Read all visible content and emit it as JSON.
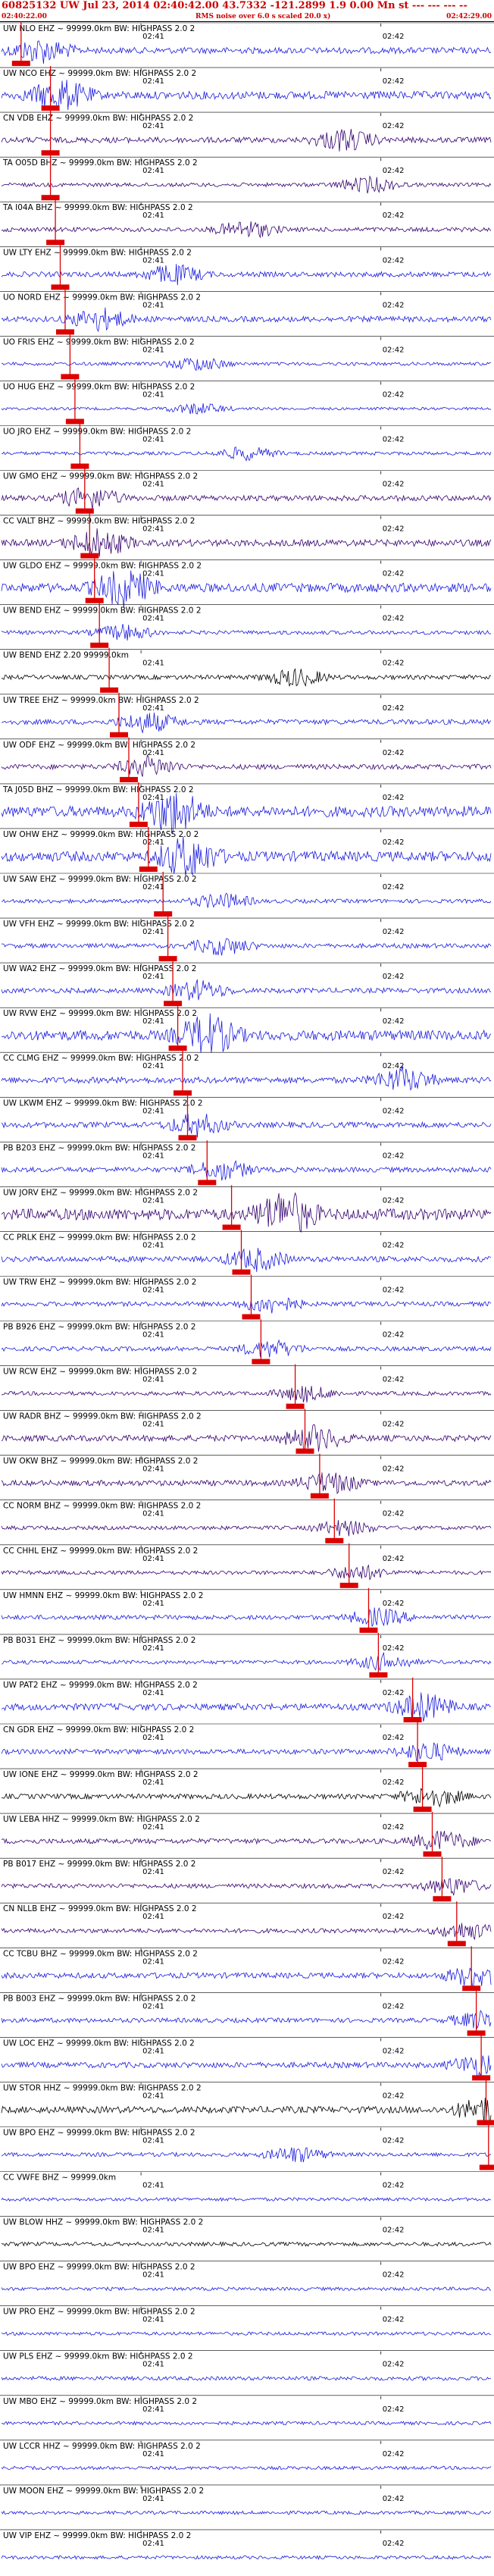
{
  "header": {
    "title": "60825132 UW Jul 23, 2014 02:40:42.00   43.7332 -121.2899  1.9 0.00 Mn st --- --- --- --",
    "start_time": "02:40:22.00",
    "noise_note": "RMS noise over 6.0 s scaled 20.0 x)",
    "end_time": "02:42:29.00"
  },
  "time_ticks": [
    "02:41",
    "02:42"
  ],
  "colors": {
    "pick": "#dd0000",
    "trace_blue": "#1a1add",
    "trace_navy": "#33006e",
    "trace_black": "#000000"
  },
  "traces": [
    {
      "label": "UW NLO EHZ ~ 99999.0km BW: HIGHPASS  2.0  2",
      "color": "blue",
      "pick": 0.04,
      "amp": 0.55,
      "burst": 0.08
    },
    {
      "label": "UW NCO EHZ ~ 99999.0km BW: HIGHPASS  2.0  2",
      "color": "blue",
      "pick": 0.1,
      "amp": 0.7,
      "burst": 0.12
    },
    {
      "label": "CN VDB EHZ ~ 99999.0km BW: HIGHPASS  2.0  2",
      "color": "navy",
      "pick": 0.1,
      "amp": 0.5,
      "burst": 0.7
    },
    {
      "label": "TA O05D BHZ ~ 99999.0km BW: HIGHPASS  2.0  2",
      "color": "navy",
      "pick": 0.1,
      "amp": 0.35,
      "burst": 0.75
    },
    {
      "label": "TA I04A BHZ ~ 99999.0km BW: HIGHPASS  2.0  2",
      "color": "navy",
      "pick": 0.11,
      "amp": 0.4,
      "burst": 0.5
    },
    {
      "label": "UW LTY EHZ ~ 99999.0km BW: HIGHPASS  2.0  2",
      "color": "blue",
      "pick": 0.12,
      "amp": 0.45,
      "burst": 0.35
    },
    {
      "label": "UO NORD EHZ ~ 99999.0km BW: HIGHPASS  2.0  2",
      "color": "blue",
      "pick": 0.13,
      "amp": 0.5,
      "burst": 0.2
    },
    {
      "label": "UO FRIS EHZ ~ 99999.0km BW: HIGHPASS  2.0  2",
      "color": "blue",
      "pick": 0.14,
      "amp": 0.3,
      "burst": 0.4
    },
    {
      "label": "UO HUG EHZ ~ 99999.0km BW: HIGHPASS  2.0  2",
      "color": "blue",
      "pick": 0.15,
      "amp": 0.25,
      "burst": 0.4
    },
    {
      "label": "UO JRO EHZ ~ 99999.0km BW: HIGHPASS  2.0  2",
      "color": "blue",
      "pick": 0.16,
      "amp": 0.3,
      "burst": 0.5
    },
    {
      "label": "UW GMO EHZ ~ 99999.0km BW: HIGHPASS  2.0  2",
      "color": "navy",
      "pick": 0.17,
      "amp": 0.5,
      "burst": 0.18
    },
    {
      "label": "CC VALT BHZ ~ 99999.0km BW: HIGHPASS  2.0  2",
      "color": "navy",
      "pick": 0.18,
      "amp": 0.6,
      "burst": 0.2
    },
    {
      "label": "UW GLDO EHZ ~ 99999.0km BW: HIGHPASS  2.0  2",
      "color": "blue",
      "pick": 0.19,
      "amp": 0.8,
      "burst": 0.25
    },
    {
      "label": "UW BEND EHZ ~ 99999.0km BW: HIGHPASS  2.0  2",
      "color": "blue",
      "pick": 0.2,
      "amp": 0.35,
      "burst": 0.25
    },
    {
      "label": "UW BEND EHZ 2.20 99999.0km",
      "color": "black",
      "pick": 0.22,
      "amp": 0.4,
      "burst": 0.6
    },
    {
      "label": "UW TREE EHZ ~ 99999.0km BW: HIGHPASS  2.0  2",
      "color": "blue",
      "pick": 0.24,
      "amp": 0.45,
      "burst": 0.3
    },
    {
      "label": "UW ODF EHZ ~ 99999.0km BW: HIGHPASS  2.0  2",
      "color": "navy",
      "pick": 0.26,
      "amp": 0.45,
      "burst": 0.3
    },
    {
      "label": "TA J05D BHZ ~ 99999.0km BW: HIGHPASS  2.0  2",
      "color": "blue",
      "pick": 0.28,
      "amp": 0.95,
      "burst": 0.35
    },
    {
      "label": "UW OHW EHZ ~ 99999.0km BW: HIGHPASS  2.0  2",
      "color": "blue",
      "pick": 0.3,
      "amp": 0.9,
      "burst": 0.38
    },
    {
      "label": "UW SAW EHZ ~ 99999.0km BW: HIGHPASS  2.0  2",
      "color": "blue",
      "pick": 0.33,
      "amp": 0.35,
      "burst": 0.45
    },
    {
      "label": "UW VFH EHZ ~ 99999.0km BW: HIGHPASS  2.0  2",
      "color": "blue",
      "pick": 0.34,
      "amp": 0.4,
      "burst": 0.45
    },
    {
      "label": "UW WA2 EHZ ~ 99999.0km BW: HIGHPASS  2.0  2",
      "color": "blue",
      "pick": 0.35,
      "amp": 0.45,
      "burst": 0.4
    },
    {
      "label": "UW RVW EHZ ~ 99999.0km BW: HIGHPASS  2.0  2",
      "color": "blue",
      "pick": 0.36,
      "amp": 0.9,
      "burst": 0.42
    },
    {
      "label": "CC CLMG EHZ ~ 99999.0km BW: HIGHPASS  2.0  2",
      "color": "blue",
      "pick": 0.37,
      "amp": 0.55,
      "burst": 0.82
    },
    {
      "label": "UW LKWM EHZ ~ 99999.0km BW: HIGHPASS  2.0  2",
      "color": "blue",
      "pick": 0.38,
      "amp": 0.5,
      "burst": 0.4
    },
    {
      "label": "PB B203 EHZ ~ 99999.0km BW: HIGHPASS  2.0  2",
      "color": "blue",
      "pick": 0.42,
      "amp": 0.45,
      "burst": 0.45
    },
    {
      "label": "UW JORV EHZ ~ 99999.0km BW: HIGHPASS  2.0  2",
      "color": "navy",
      "pick": 0.47,
      "amp": 1.0,
      "burst": 0.58
    },
    {
      "label": "CC PRLK EHZ ~ 99999.0km BW: HIGHPASS  2.0  2",
      "color": "blue",
      "pick": 0.49,
      "amp": 0.5,
      "burst": 0.52
    },
    {
      "label": "UW TRW EHZ ~ 99999.0km BW: HIGHPASS  2.0  2",
      "color": "blue",
      "pick": 0.51,
      "amp": 0.4,
      "burst": 0.55
    },
    {
      "label": "PB B926 EHZ ~ 99999.0km BW: HIGHPASS  2.0  2",
      "color": "blue",
      "pick": 0.53,
      "amp": 0.4,
      "burst": 0.55
    },
    {
      "label": "UW RCW EHZ ~ 99999.0km BW: HIGHPASS  2.0  2",
      "color": "navy",
      "pick": 0.6,
      "amp": 0.35,
      "burst": 0.62
    },
    {
      "label": "UW RADR BHZ ~ 99999.0km BW: HIGHPASS  2.0  2",
      "color": "navy",
      "pick": 0.62,
      "amp": 0.55,
      "burst": 0.64
    },
    {
      "label": "UW OKW BHZ ~ 99999.0km BW: HIGHPASS  2.0  2",
      "color": "navy",
      "pick": 0.65,
      "amp": 0.5,
      "burst": 0.67
    },
    {
      "label": "CC NORM BHZ ~ 99999.0km BW: HIGHPASS  2.0  2",
      "color": "navy",
      "pick": 0.68,
      "amp": 0.35,
      "burst": 0.7
    },
    {
      "label": "CC CHHL EHZ ~ 99999.0km BW: HIGHPASS  2.0  2",
      "color": "navy",
      "pick": 0.71,
      "amp": 0.35,
      "burst": 0.73
    },
    {
      "label": "UW HMNN EHZ ~ 99999.0km BW: HIGHPASS  2.0  2",
      "color": "blue",
      "pick": 0.75,
      "amp": 0.4,
      "burst": 0.77
    },
    {
      "label": "PB B031 EHZ ~ 99999.0km BW: HIGHPASS  2.0  2",
      "color": "blue",
      "pick": 0.77,
      "amp": 0.35,
      "burst": 0.78
    },
    {
      "label": "UW PAT2 EHZ ~ 99999.0km BW: HIGHPASS  2.0  2",
      "color": "blue",
      "pick": 0.84,
      "amp": 0.6,
      "burst": 0.86
    },
    {
      "label": "CN GDR EHZ ~ 99999.0km BW: HIGHPASS  2.0  2",
      "color": "blue",
      "pick": 0.85,
      "amp": 0.45,
      "burst": 0.87
    },
    {
      "label": "UW IONE EHZ ~ 99999.0km BW: HIGHPASS  2.0  2",
      "color": "black",
      "pick": 0.86,
      "amp": 0.45,
      "burst": 0.88
    },
    {
      "label": "UW LEBA HHZ ~ 99999.0km BW: HIGHPASS  2.0  2",
      "color": "navy",
      "pick": 0.88,
      "amp": 0.45,
      "burst": 0.9
    },
    {
      "label": "PB B017 EHZ ~ 99999.0km BW: HIGHPASS  2.0  2",
      "color": "navy",
      "pick": 0.9,
      "amp": 0.4,
      "burst": 0.92
    },
    {
      "label": "CN NLLB EHZ ~ 99999.0km BW: HIGHPASS  2.0  2",
      "color": "navy",
      "pick": 0.93,
      "amp": 0.4,
      "burst": 0.95
    },
    {
      "label": "CC TCBU BHZ ~ 99999.0km BW: HIGHPASS  2.0  2",
      "color": "blue",
      "pick": 0.96,
      "amp": 0.5,
      "burst": 0.97
    },
    {
      "label": "PB B003 EHZ ~ 99999.0km BW: HIGHPASS  2.0  2",
      "color": "blue",
      "pick": 0.97,
      "amp": 0.4,
      "burst": 0.98
    },
    {
      "label": "UW LOC EHZ ~ 99999.0km BW: HIGHPASS  2.0  2",
      "color": "blue",
      "pick": 0.98,
      "amp": 0.5,
      "burst": 0.98
    },
    {
      "label": "UW STOR HHZ ~ 99999.0km BW: HIGHPASS  2.0  2",
      "color": "black",
      "pick": 0.99,
      "amp": 0.6,
      "burst": 0.99
    },
    {
      "label": "UW BPO EHZ ~ 99999.0km BW: HIGHPASS  2.0  2",
      "color": "blue",
      "pick": 0.995,
      "amp": 0.35,
      "burst": 0.6
    },
    {
      "label": "CC VWFE BHZ ~ 99999.0km",
      "color": "blue",
      "pick": null,
      "amp": 0.3,
      "burst": null
    },
    {
      "label": "UW BLOW HHZ ~ 99999.0km BW: HIGHPASS  2.0  2",
      "color": "black",
      "pick": null,
      "amp": 0.35,
      "burst": null
    },
    {
      "label": "UW BPO EHZ ~ 99999.0km BW: HIGHPASS  2.0  2",
      "color": "blue",
      "pick": null,
      "amp": 0.3,
      "burst": null
    },
    {
      "label": "UW PRO EHZ ~ 99999.0km BW: HIGHPASS  2.0  2",
      "color": "blue",
      "pick": null,
      "amp": 0.3,
      "burst": null
    },
    {
      "label": "UW PLS EHZ ~ 99999.0km BW: HIGHPASS  2.0  2",
      "color": "blue",
      "pick": null,
      "amp": 0.35,
      "burst": null
    },
    {
      "label": "UW MBO EHZ ~ 99999.0km BW: HIGHPASS  2.0  2",
      "color": "blue",
      "pick": null,
      "amp": 0.3,
      "burst": null
    },
    {
      "label": "UW LCCR HHZ ~ 99999.0km BW: HIGHPASS  2.0  2",
      "color": "blue",
      "pick": null,
      "amp": 0.3,
      "burst": null
    },
    {
      "label": "UW MOON EHZ ~ 99999.0km BW: HIGHPASS  2.0  2",
      "color": "blue",
      "pick": null,
      "amp": 0.3,
      "burst": null
    },
    {
      "label": "UW VIP EHZ ~ 99999.0km BW: HIGHPASS  2.0  2",
      "color": "blue",
      "pick": null,
      "amp": 0.3,
      "burst": null
    }
  ]
}
